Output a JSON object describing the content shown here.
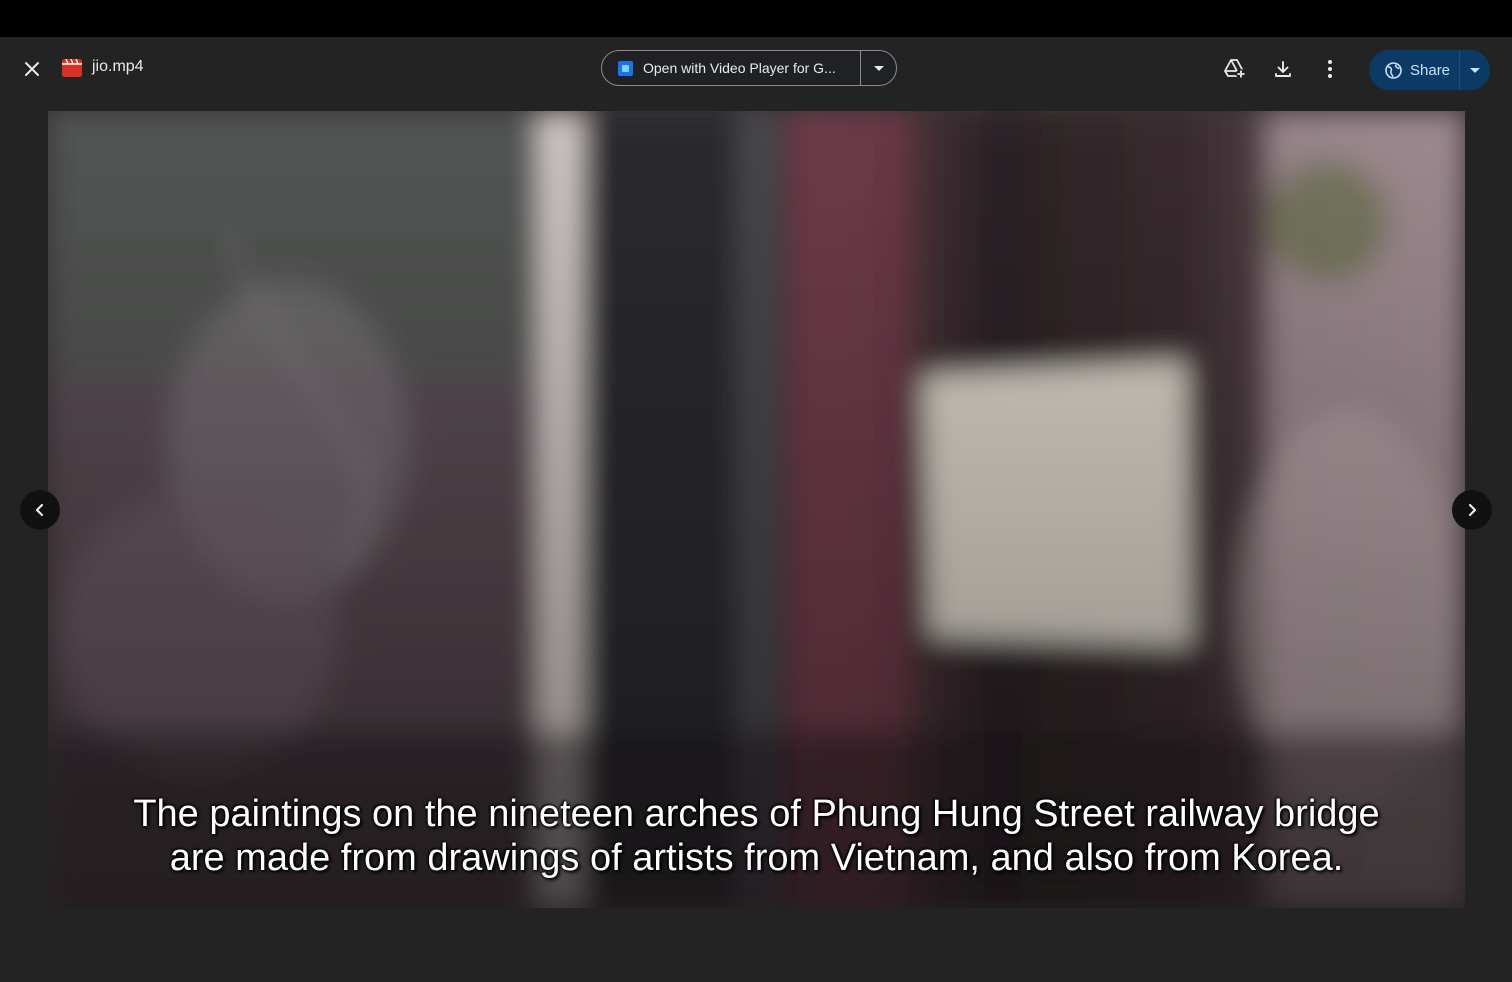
{
  "header": {
    "file_name": "jio.mp4",
    "open_with_label": "Open with Video Player for G...",
    "share_label": "Share"
  },
  "video": {
    "subtitle_line1": "The paintings on the nineteen arches of Phung Hung Street railway bridge",
    "subtitle_line2": "are made from drawings of artists from Vietnam, and also from Korea."
  },
  "colors": {
    "share_bg": "#0b3a67",
    "file_icon": "#d93025",
    "app_icon": "#1a73e8"
  },
  "icons": [
    "close-icon",
    "video-file-icon",
    "app-icon",
    "chevron-down-icon",
    "add-to-drive-icon",
    "download-icon",
    "more-vert-icon",
    "globe-icon",
    "chevron-left-icon",
    "chevron-right-icon"
  ]
}
